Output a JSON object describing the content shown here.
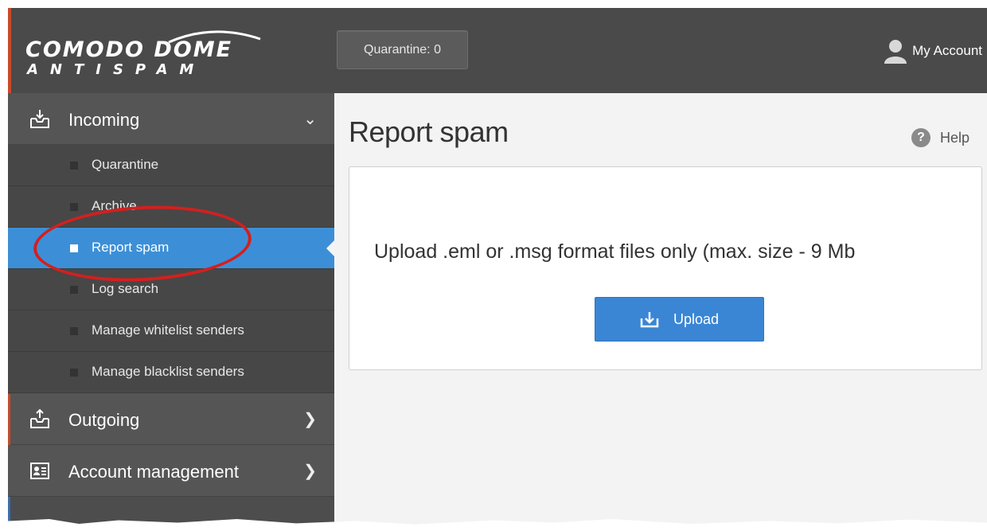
{
  "header": {
    "logo": {
      "line1": "COMODO DOME",
      "line2": "ANTISPAM"
    },
    "quarantine_label": "Quarantine: 0",
    "account_label": "My Account"
  },
  "sidebar": {
    "sections": [
      {
        "label": "Incoming",
        "icon": "inbox-in-icon",
        "chevron": "chevron-down-icon",
        "expanded": true
      },
      {
        "label": "Outgoing",
        "icon": "inbox-out-icon",
        "chevron": "chevron-right-icon",
        "expanded": false
      },
      {
        "label": "Account management",
        "icon": "id-card-icon",
        "chevron": "chevron-right-icon",
        "expanded": false
      }
    ],
    "incoming_items": [
      {
        "label": "Quarantine"
      },
      {
        "label": "Archive"
      },
      {
        "label": "Report spam",
        "active": true
      },
      {
        "label": "Log search"
      },
      {
        "label": "Manage whitelist senders"
      },
      {
        "label": "Manage blacklist senders"
      }
    ]
  },
  "main": {
    "title": "Report spam",
    "help_label": "Help",
    "upload_message": "Upload .eml or .msg format files only (max. size - 9 Mb",
    "upload_button_label": "Upload"
  },
  "colors": {
    "topbar": "#4a4a4a",
    "sidebar": "#4d4d4d",
    "active_item": "#3c8fd6",
    "upload_button": "#3a86d4",
    "annotation": "#d41f1f"
  }
}
